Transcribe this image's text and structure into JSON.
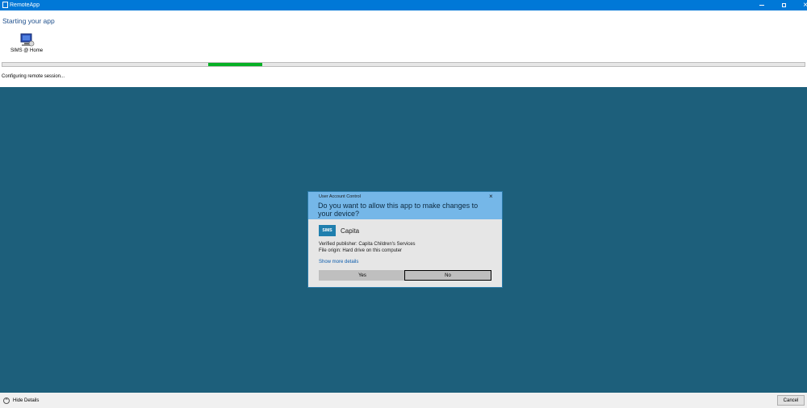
{
  "window": {
    "title": "RemoteApp",
    "icon": "remoteapp-icon",
    "controls": {
      "minimize": "minimize-icon",
      "maximize": "maximize-icon",
      "close": "×"
    }
  },
  "main": {
    "heading": "Starting your app",
    "app": {
      "name": "SIMS @ Home",
      "icon": "remote-computer-icon"
    },
    "progress": {
      "fill_start": 0.257,
      "fill_fraction": 0.067,
      "color": "#06b025"
    },
    "status": "Configuring remote session..."
  },
  "remote_background": "#1d5f7b",
  "uac": {
    "caption": "User Account Control",
    "close": "×",
    "question": "Do you want to allow this app to make changes to your device?",
    "publisher_logo_text": "SIMS",
    "publisher_name": "Capita",
    "verified_publisher": "Verified publisher: Capita Children's Services",
    "file_origin": "File origin: Hard drive on this computer",
    "show_more": "Show more details",
    "yes_label": "Yes",
    "no_label": "No",
    "header_color": "#75b7e8"
  },
  "footer": {
    "toggle_icon": "^",
    "toggle_label": "Hide Details",
    "cancel_label": "Cancel"
  }
}
